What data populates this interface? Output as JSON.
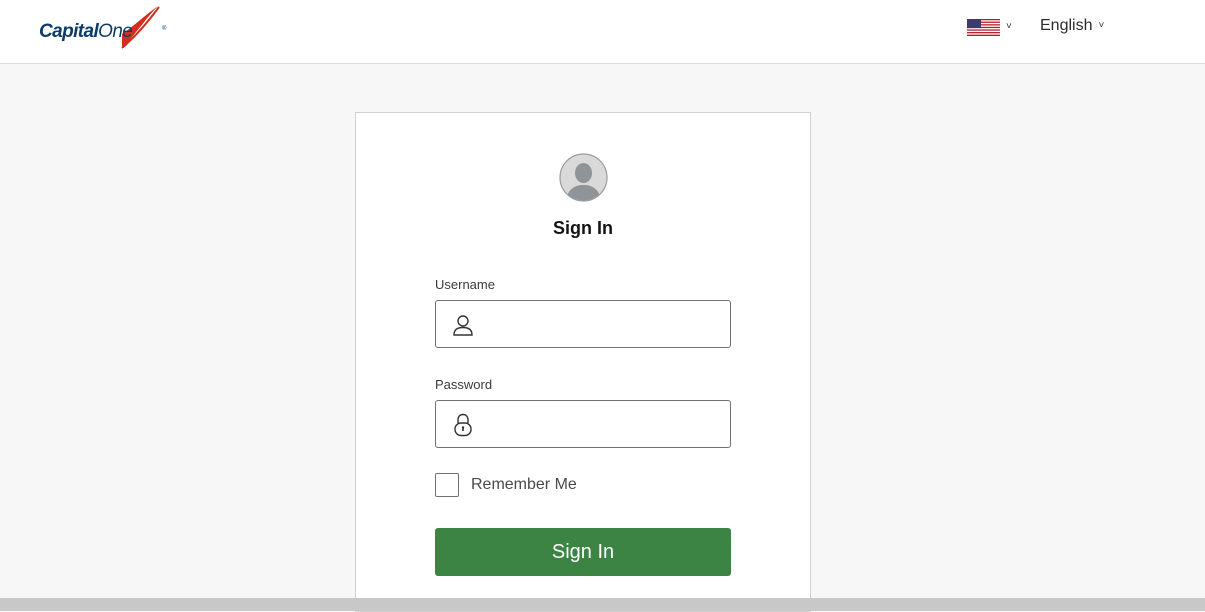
{
  "header": {
    "logo_text_capital": "Capital",
    "logo_text_one": "One",
    "logo_registered": "®",
    "country": {
      "icon": "us-flag-icon",
      "chevron": "˅"
    },
    "language": {
      "label": "English",
      "chevron": "˅"
    }
  },
  "signin": {
    "title": "Sign In",
    "username": {
      "label": "Username",
      "value": "",
      "icon": "user-icon"
    },
    "password": {
      "label": "Password",
      "value": "",
      "icon": "lock-icon"
    },
    "remember_label": "Remember Me",
    "remember_checked": false,
    "button_label": "Sign In"
  },
  "colors": {
    "brand_navy": "#0b3d6b",
    "brand_red": "#d22e1e",
    "button_green": "#3b8444",
    "page_bg": "#f7f7f7"
  }
}
